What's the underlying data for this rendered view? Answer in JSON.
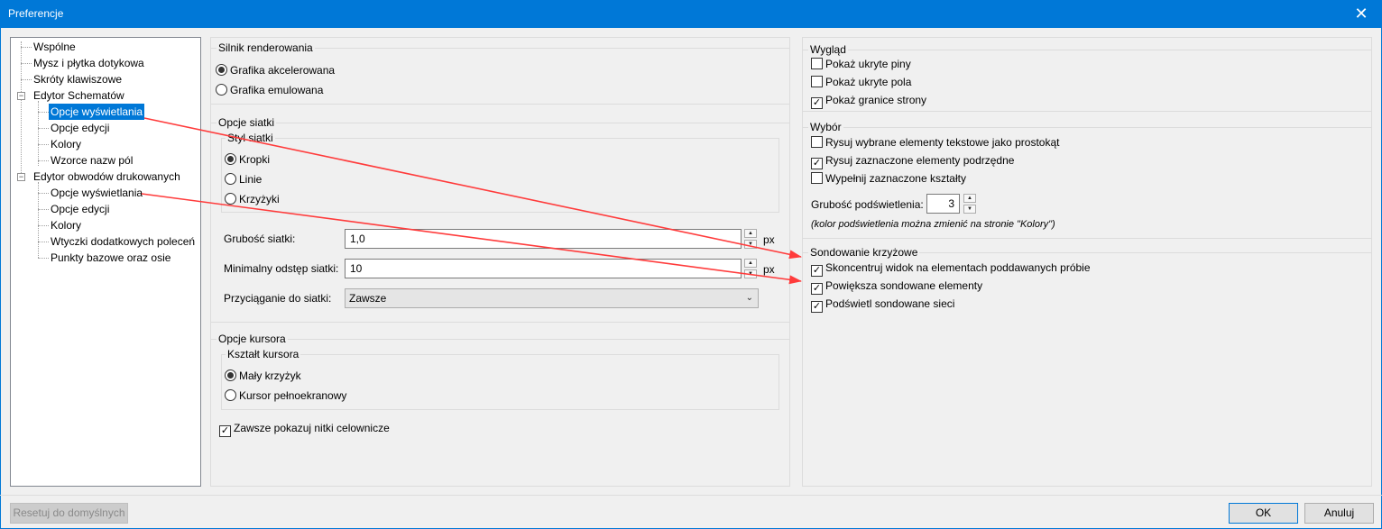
{
  "window": {
    "title": "Preferencje",
    "close_glyph": "✕"
  },
  "tree": {
    "items": [
      "Wspólne",
      "Mysz i płytka dotykowa",
      "Skróty klawiszowe",
      "Edytor Schematów",
      "Opcje wyświetlania",
      "Opcje edycji",
      "Kolory",
      "Wzorce nazw pól",
      "Edytor obwodów drukowanych",
      "Opcje wyświetlania",
      "Opcje edycji",
      "Kolory",
      "Wtyczki dodatkowych poleceń",
      "Punkty bazowe oraz osie"
    ],
    "expander": "−"
  },
  "render": {
    "title": "Silnik renderowania",
    "opt1": "Grafika akcelerowana",
    "opt2": "Grafika emulowana"
  },
  "grid": {
    "title": "Opcje siatki",
    "style_title": "Styl siatki",
    "style_opt1": "Kropki",
    "style_opt2": "Linie",
    "style_opt3": "Krzyżyki",
    "size_label": "Grubość siatki:",
    "size_value": "1,0",
    "min_label": "Minimalny odstęp siatki:",
    "min_value": "10",
    "unit": "px",
    "snap_label": "Przyciąganie do siatki:",
    "snap_value": "Zawsze"
  },
  "cursor": {
    "title": "Opcje kursora",
    "shape_title": "Kształt kursora",
    "opt1": "Mały krzyżyk",
    "opt2": "Kursor pełnoekranowy",
    "crosshair": "Zawsze pokazuj nitki celownicze"
  },
  "appearance": {
    "title": "Wygląd",
    "c1": "Pokaż ukryte piny",
    "c2": "Pokaż ukryte pola",
    "c3": "Pokaż granice strony"
  },
  "selection": {
    "title": "Wybór",
    "c1": "Rysuj wybrane elementy tekstowe jako prostokąt",
    "c2": "Rysuj zaznaczone elementy podrzędne",
    "c3": "Wypełnij zaznaczone kształty",
    "thick_label": "Grubość podświetlenia:",
    "thick_value": "3",
    "note": "(kolor podświetlenia można zmienić na stronie \"Kolory\")"
  },
  "cross": {
    "title": "Sondowanie krzyżowe",
    "c1": "Skoncentruj widok na elementach poddawanych próbie",
    "c2": "Powiększa sondowane elementy",
    "c3": "Podświetl sondowane sieci"
  },
  "buttons": {
    "reset": "Resetuj do domyślnych",
    "ok": "OK",
    "cancel": "Anuluj"
  },
  "glyphs": {
    "check": "✓",
    "up": "▲",
    "down": "▼",
    "chev": "⌄"
  },
  "colors": {
    "titlebar": "#0078d7",
    "selection": "#0078d7",
    "arrow": "#ff3b3b"
  }
}
